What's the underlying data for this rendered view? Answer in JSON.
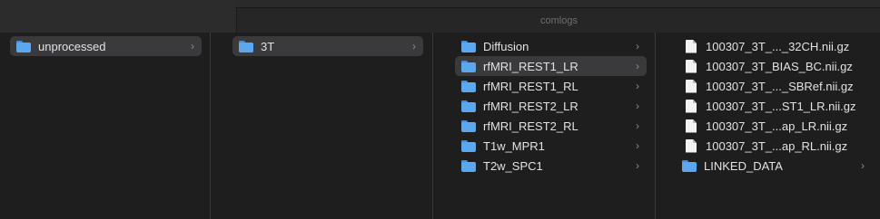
{
  "window": {
    "tab_title": "comlogs"
  },
  "columns": [
    {
      "items": [
        {
          "label": "unprocessed",
          "icon": "folder-icon",
          "selected": true,
          "chevron": "›"
        }
      ]
    },
    {
      "items": [
        {
          "label": "3T",
          "icon": "folder-icon",
          "selected": true,
          "chevron": "›"
        }
      ]
    },
    {
      "items": [
        {
          "label": "Diffusion",
          "icon": "folder-icon",
          "selected": false,
          "chevron": "›"
        },
        {
          "label": "rfMRI_REST1_LR",
          "icon": "folder-icon",
          "selected": true,
          "chevron": "›"
        },
        {
          "label": "rfMRI_REST1_RL",
          "icon": "folder-icon",
          "selected": false,
          "chevron": "›"
        },
        {
          "label": "rfMRI_REST2_LR",
          "icon": "folder-icon",
          "selected": false,
          "chevron": "›"
        },
        {
          "label": "rfMRI_REST2_RL",
          "icon": "folder-icon",
          "selected": false,
          "chevron": "›"
        },
        {
          "label": "T1w_MPR1",
          "icon": "folder-icon",
          "selected": false,
          "chevron": "›"
        },
        {
          "label": "T2w_SPC1",
          "icon": "folder-icon",
          "selected": false,
          "chevron": "›"
        }
      ]
    },
    {
      "items": [
        {
          "label": "100307_3T_..._32CH.nii.gz",
          "icon": "document-icon"
        },
        {
          "label": "100307_3T_BIAS_BC.nii.gz",
          "icon": "document-icon"
        },
        {
          "label": "100307_3T_..._SBRef.nii.gz",
          "icon": "document-icon"
        },
        {
          "label": "100307_3T_...ST1_LR.nii.gz",
          "icon": "document-icon"
        },
        {
          "label": "100307_3T_...ap_LR.nii.gz",
          "icon": "document-icon"
        },
        {
          "label": "100307_3T_...ap_RL.nii.gz",
          "icon": "document-icon"
        },
        {
          "label": "LINKED_DATA",
          "icon": "folder-icon",
          "chevron": "›"
        }
      ]
    }
  ]
}
